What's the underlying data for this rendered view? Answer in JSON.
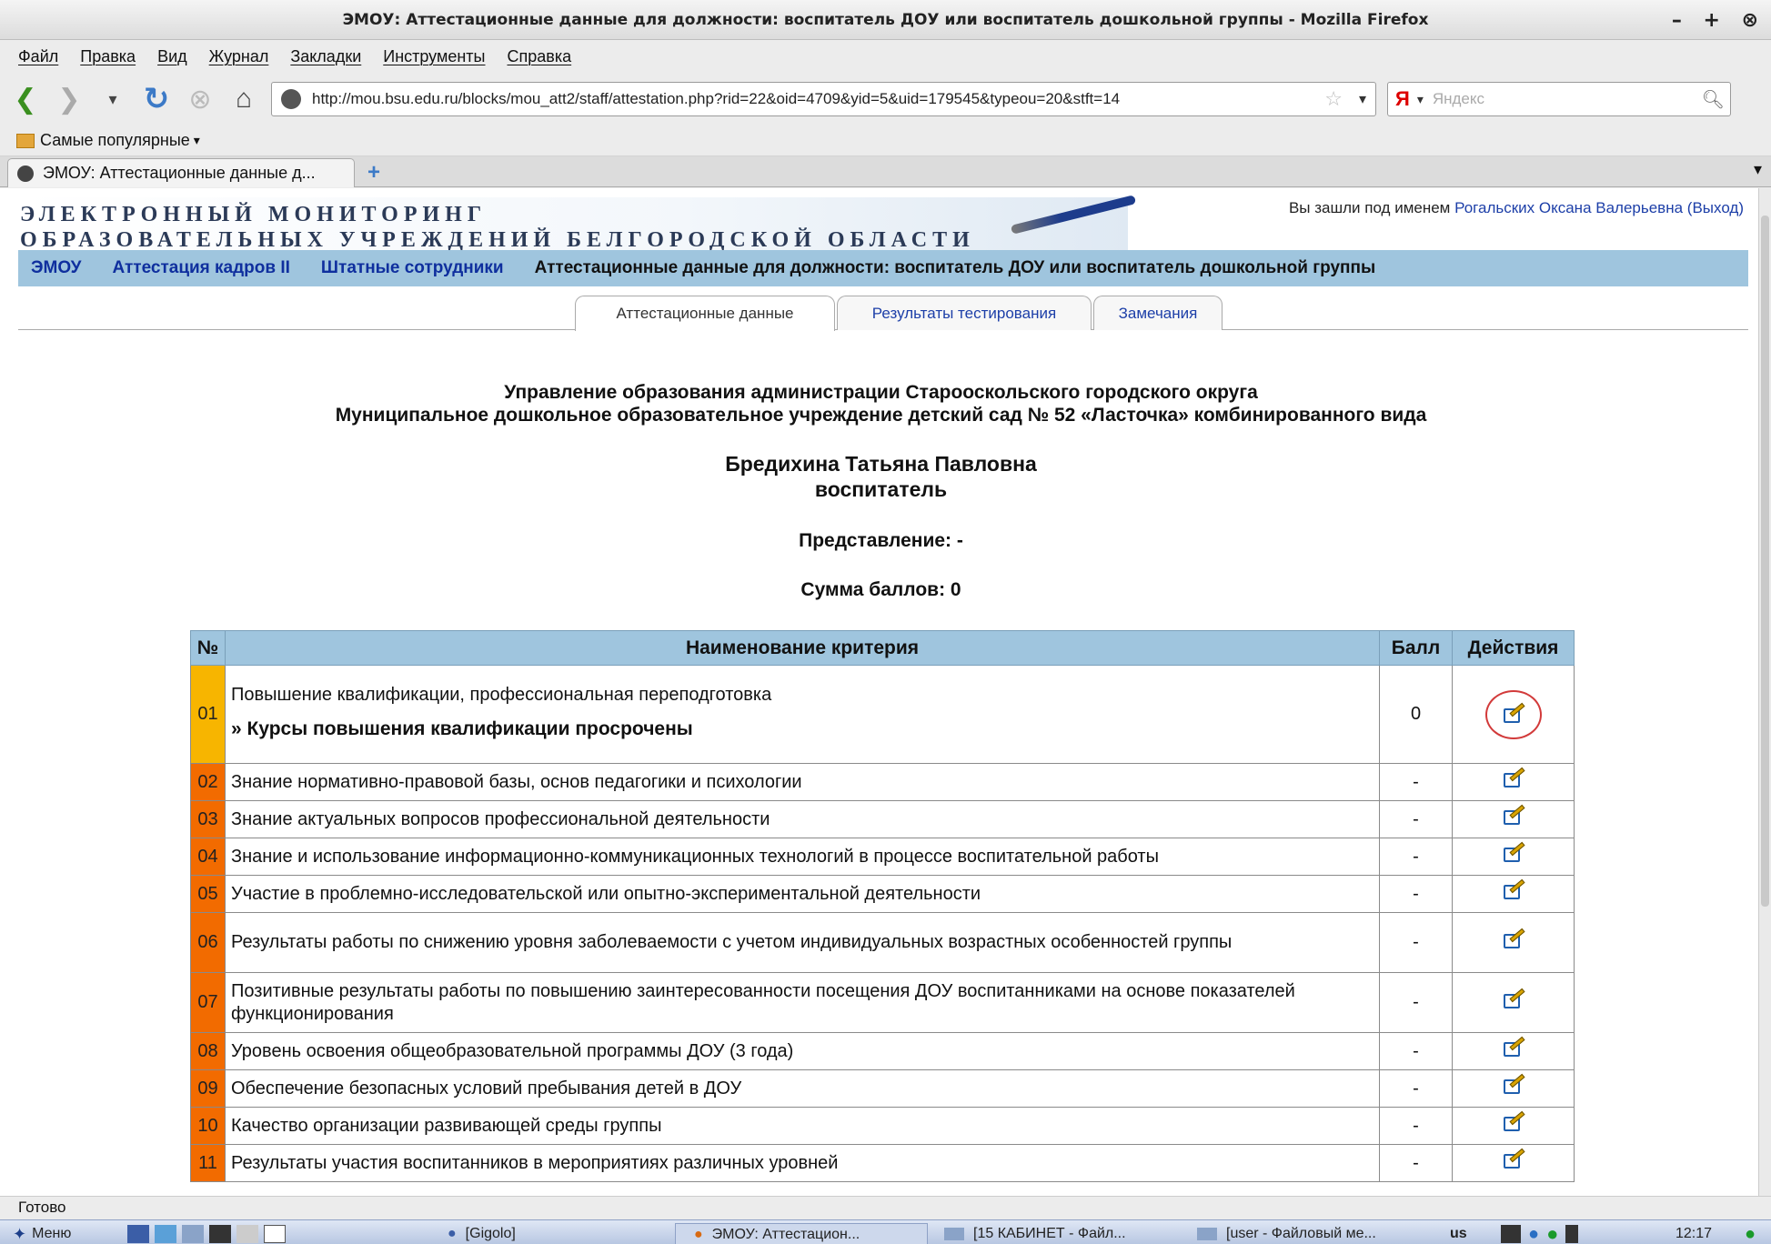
{
  "window": {
    "title": "ЭМОУ: Аттестационные данные для должности: воспитатель ДОУ или воспитатель дошкольной группы - Mozilla Firefox",
    "controls": "– + ⊗"
  },
  "menu": [
    "Файл",
    "Правка",
    "Вид",
    "Журнал",
    "Закладки",
    "Инструменты",
    "Справка"
  ],
  "nav": {
    "url": "http://mou.bsu.edu.ru/blocks/mou_att2/staff/attestation.php?rid=22&oid=4709&yid=5&uid=179545&typeou=20&stft=14",
    "search_placeholder": "Яндекс",
    "search_logo": "Я"
  },
  "bookmarks": {
    "label": "Самые популярные"
  },
  "browser_tab": {
    "label": "ЭМОУ: Аттестационные данные д...",
    "new_tab": "+"
  },
  "site": {
    "banner_line1": "ЭЛЕКТРОННЫЙ МОНИТОРИНГ",
    "banner_line2": "ОБРАЗОВАТЕЛЬНЫХ УЧРЕЖДЕНИЙ БЕЛГОРОДСКОЙ ОБЛАСТИ",
    "login_prefix": "Вы зашли под именем",
    "login_user": "Рогальских Оксана Валерьевна",
    "logout": "(Выход)"
  },
  "breadcrumbs": {
    "items": [
      "ЭМОУ",
      "Аттестация кадров II",
      "Штатные сотрудники"
    ],
    "current": "Аттестационные данные для должности: воспитатель ДОУ или воспитатель дошкольной группы"
  },
  "page_tabs": [
    "Аттестационные данные",
    "Результаты тестирования",
    "Замечания"
  ],
  "header": {
    "org_line1": "Управление образования администрации Старооскольского городского округа",
    "org_line2": "Муниципальное дошкольное образовательное учреждение детский сад № 52 «Ласточка» комбинированного вида",
    "name": "Бредихина Татьяна Павловна",
    "position": "воспитатель",
    "representation": "Представление: -",
    "score_sum": "Сумма баллов: 0"
  },
  "table": {
    "headers": [
      "№",
      "Наименование критерия",
      "Балл",
      "Действия"
    ],
    "rows": [
      {
        "num": "01",
        "name": "Повышение квалификации, профессиональная переподготовка",
        "sub": "» Курсы повышения квалификации просрочены",
        "score": "0"
      },
      {
        "num": "02",
        "name": "Знание нормативно-правовой базы, основ педагогики и психологии",
        "score": "-"
      },
      {
        "num": "03",
        "name": "Знание актуальных вопросов профессиональной деятельности",
        "score": "-"
      },
      {
        "num": "04",
        "name": "Знание и использование информационно-коммуникационных технологий в процессе воспитательной работы",
        "score": "-"
      },
      {
        "num": "05",
        "name": "Участие в проблемно-исследовательской или опытно-экспериментальной деятельности",
        "score": "-"
      },
      {
        "num": "06",
        "name": "Результаты работы по снижению уровня заболеваемости с учетом индивидуальных возрастных особенностей группы",
        "score": "-"
      },
      {
        "num": "07",
        "name": "Позитивные результаты работы по повышению заинтересованности посещения ДОУ воспитанниками на основе показателей функционирования",
        "score": "-"
      },
      {
        "num": "08",
        "name": "Уровень освоения общеобразовательной программы ДОУ (3 года)",
        "score": "-"
      },
      {
        "num": "09",
        "name": "Обеспечение безопасных условий пребывания детей в ДОУ",
        "score": "-"
      },
      {
        "num": "10",
        "name": "Качество организации развивающей среды группы",
        "score": "-"
      },
      {
        "num": "11",
        "name": "Результаты участия воспитанников в мероприятиях различных уровней",
        "score": "-"
      }
    ]
  },
  "status": "Готово",
  "taskbar": {
    "menu": "Меню",
    "gigolo": "[Gigolo]",
    "firefox": "ЭМОУ: Аттестацион...",
    "files1": "[15 КАБИНЕТ - Файл...",
    "files2": "[user - Файловый ме...",
    "layout": "us",
    "clock": "12:17"
  }
}
